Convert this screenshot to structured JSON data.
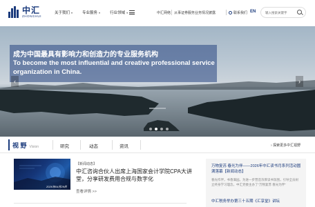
{
  "brand": {
    "name_cn": "中汇",
    "name_en": "ZHONGHUI",
    "color": "#1a3a7c"
  },
  "nav": {
    "items": [
      {
        "label": "关于我们"
      },
      {
        "label": "专业服务"
      },
      {
        "label": "行业领域"
      }
    ]
  },
  "utility": {
    "network_label": "中汇网络",
    "notice_label": "从事证券服务业务情况披露",
    "contact_label": "联系我们",
    "language": "EN",
    "search_placeholder": "输入搜索关键字"
  },
  "hero": {
    "title_cn": "成为中国最具有影响力和创造力的专业服务机构",
    "title_en": "To become the most influential and creative professional service organization in China.",
    "slide_count": 4,
    "active_slide": 2
  },
  "tabs": {
    "title_cn": "视 野",
    "title_en": "Vision",
    "items": [
      {
        "label": "研究"
      },
      {
        "label": "动态"
      },
      {
        "label": "资讯"
      }
    ],
    "more_label": "探索更多中汇视野"
  },
  "news": {
    "category": "【新闻动态】",
    "title": "中汇咨询合伙人出席上海国家会计学院CPA大讲堂，分享研发费用合规与数字化",
    "date": "2026年04月29日",
    "more_label": "查看详情 >>"
  },
  "side_panel": {
    "title": "万物复苏 春光为伴——2026年中汇读书月系列活动圆满落幕",
    "title_tag": "【新闻动态】",
    "description": "春光作伴，书香满园。为进一步营造浓厚读书氛围，引导全员树立终身学习理念，中汇党委主办了“万物复苏 春光为伴”",
    "title2": "中汇税务举办第三十五期《汇享堂》讲坛"
  }
}
